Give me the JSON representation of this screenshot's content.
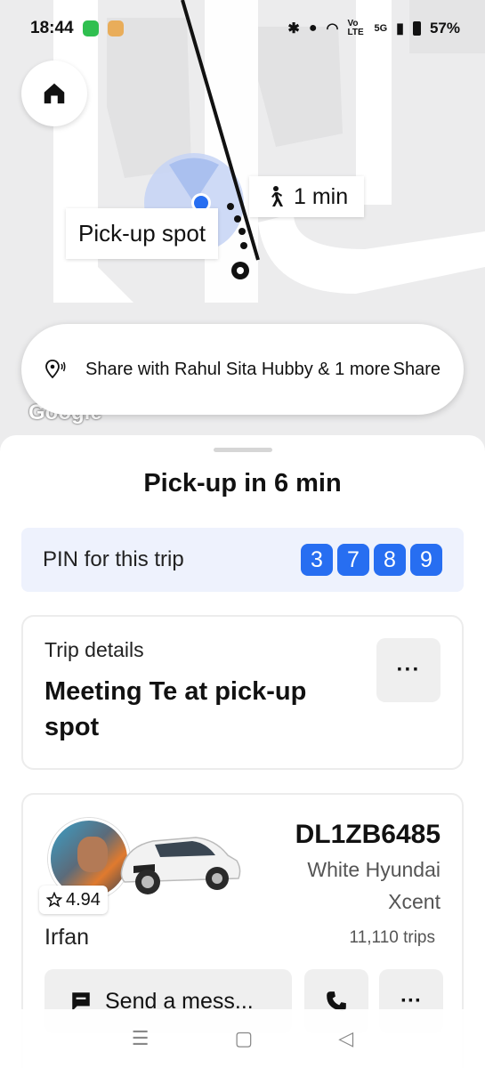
{
  "status_bar": {
    "time": "18:44",
    "network_label": "Vo LTE",
    "signal_label": "5G",
    "battery": "57%"
  },
  "map": {
    "walk_time": "1 min",
    "pickup_label": "Pick-up spot",
    "attribution": "Google"
  },
  "share": {
    "text": "Share with Rahul Sita Hubby & 1 more",
    "button": "Share"
  },
  "sheet": {
    "title": "Pick-up in 6 min",
    "pin_label": "PIN for this trip",
    "pin_digits": [
      "3",
      "7",
      "8",
      "9"
    ],
    "pin_color": "#276ef1"
  },
  "trip": {
    "subtitle": "Trip details",
    "main": "Meeting Te at pick-up spot",
    "more": "···"
  },
  "driver": {
    "rating": "4.94",
    "plate": "DL1ZB6485",
    "car_model": "White Hyundai Xcent",
    "name": "Irfan",
    "trips": "11,110 trips",
    "message_button": "Send a mess...",
    "more": "···"
  },
  "icons": {
    "home": "home-icon",
    "walk": "walking-person-icon",
    "share_pin": "location-share-icon",
    "star": "star-icon",
    "message": "message-icon",
    "phone": "phone-icon"
  }
}
